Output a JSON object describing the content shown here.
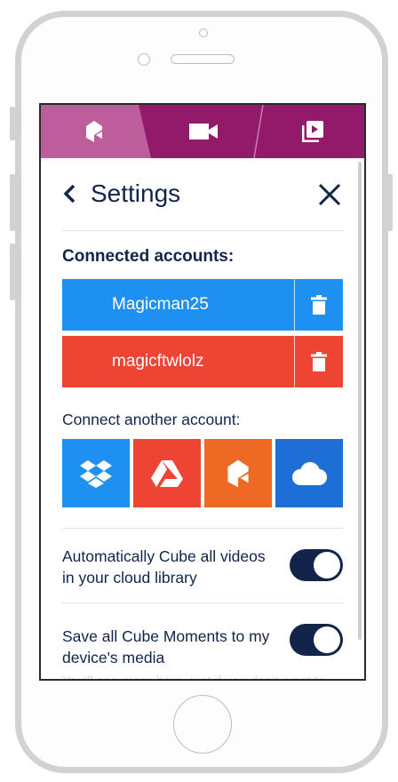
{
  "tabs": [
    {
      "icon": "cube-icon",
      "active": true
    },
    {
      "icon": "video-camera-icon",
      "active": false
    },
    {
      "icon": "playlist-play-icon",
      "active": false
    }
  ],
  "header": {
    "title": "Settings",
    "back_icon": "chevron-left-icon",
    "close_icon": "close-icon"
  },
  "connected": {
    "title": "Connected accounts:",
    "accounts": [
      {
        "name": "Magicman25",
        "color": "#1e90f0",
        "icon": "trash-icon"
      },
      {
        "name": "magicftwlolz",
        "color": "#ee4433",
        "icon": "trash-icon"
      }
    ]
  },
  "connect_another": {
    "label": "Connect another account:",
    "services": [
      {
        "icon": "dropbox-icon",
        "color": "#1e90f0"
      },
      {
        "icon": "google-drive-icon",
        "color": "#ee4433"
      },
      {
        "icon": "cube-icon",
        "color": "#ee6a24"
      },
      {
        "icon": "cloud-icon",
        "color": "#1d6fd6"
      }
    ]
  },
  "settings": [
    {
      "label": "Automatically Cube all videos in your cloud library",
      "enabled": true
    },
    {
      "label": "Save all Cube Moments to my device's media",
      "enabled": true
    }
  ],
  "faded_note": "You'll see more here, just if you don't want to",
  "colors": {
    "brand": "#93196a",
    "navy": "#13244a"
  }
}
